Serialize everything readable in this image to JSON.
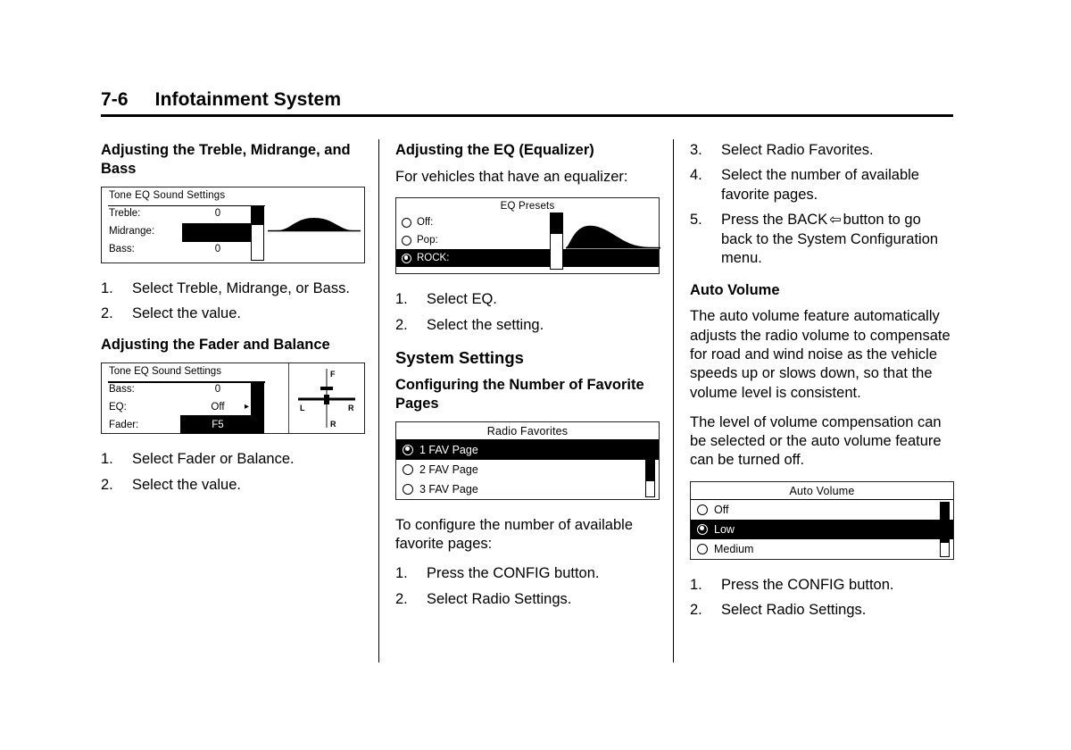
{
  "header": {
    "page_number": "7-6",
    "title": "Infotainment System"
  },
  "columns": {
    "left": {
      "heading1": "Adjusting the Treble, Midrange, and Bass",
      "tone_panel": {
        "title": "Tone EQ Sound Settings",
        "rows": [
          {
            "label": "Treble:",
            "value": "0"
          },
          {
            "label": "Midrange:",
            "value": ""
          },
          {
            "label": "Bass:",
            "value": "0"
          }
        ]
      },
      "steps1": [
        {
          "num": "1.",
          "text": "Select Treble, Midrange, or Bass."
        },
        {
          "num": "2.",
          "text": "Select the value."
        }
      ],
      "heading2": "Adjusting the Fader and Balance",
      "fader_panel": {
        "title": "Tone EQ Sound Settings",
        "rows": [
          {
            "label": "Bass:",
            "value": "0"
          },
          {
            "label": "EQ:",
            "value": "Off"
          },
          {
            "label": "Fader:",
            "value": "F5"
          }
        ],
        "arrow": "▸",
        "axis_labels": {
          "front": "F",
          "left": "L",
          "right": "R",
          "rear": "R"
        }
      },
      "steps2": [
        {
          "num": "1.",
          "text": "Select Fader or Balance."
        },
        {
          "num": "2.",
          "text": "Select the value."
        }
      ]
    },
    "middle": {
      "heading1": "Adjusting the EQ (Equalizer)",
      "intro": "For vehicles that have an equalizer:",
      "eq_panel": {
        "title": "EQ Presets",
        "items": [
          {
            "label": "Off:",
            "selected": false
          },
          {
            "label": "Pop:",
            "selected": false
          },
          {
            "label": "ROCK:",
            "selected": true
          }
        ]
      },
      "steps1": [
        {
          "num": "1.",
          "text": "Select EQ."
        },
        {
          "num": "2.",
          "text": "Select the setting."
        }
      ],
      "heading2": "System Settings",
      "heading3": "Configuring the Number of Favorite Pages",
      "fav_panel": {
        "title": "Radio Favorites",
        "items": [
          {
            "label": "1 FAV Page",
            "selected": true
          },
          {
            "label": "2 FAV Page",
            "selected": false
          },
          {
            "label": "3 FAV Page",
            "selected": false
          }
        ]
      },
      "intro2": "To configure the number of available favorite pages:",
      "steps2": [
        {
          "num": "1.",
          "text": "Press the CONFIG button."
        },
        {
          "num": "2.",
          "text": "Select Radio Settings."
        }
      ]
    },
    "right": {
      "steps1": [
        {
          "num": "3.",
          "text": "Select Radio Favorites."
        },
        {
          "num": "4.",
          "text": "Select the number of available favorite pages."
        }
      ],
      "step5": {
        "num": "5.",
        "text_before": "Press the BACK",
        "glyph": "⇦",
        "text_after": "button to go back to the System Configuration menu."
      },
      "heading1": "Auto Volume",
      "para1": "The auto volume feature automatically adjusts the radio volume to compensate for road and wind noise as the vehicle speeds up or slows down, so that the volume level is consistent.",
      "para2": "The level of volume compensation can be selected or the auto volume feature can be turned off.",
      "av_panel": {
        "title": "Auto Volume",
        "items": [
          {
            "label": "Off",
            "selected": false
          },
          {
            "label": "Low",
            "selected": true
          },
          {
            "label": "Medium",
            "selected": false
          }
        ]
      },
      "steps2": [
        {
          "num": "1.",
          "text": "Press the CONFIG button."
        },
        {
          "num": "2.",
          "text": "Select Radio Settings."
        }
      ]
    }
  }
}
